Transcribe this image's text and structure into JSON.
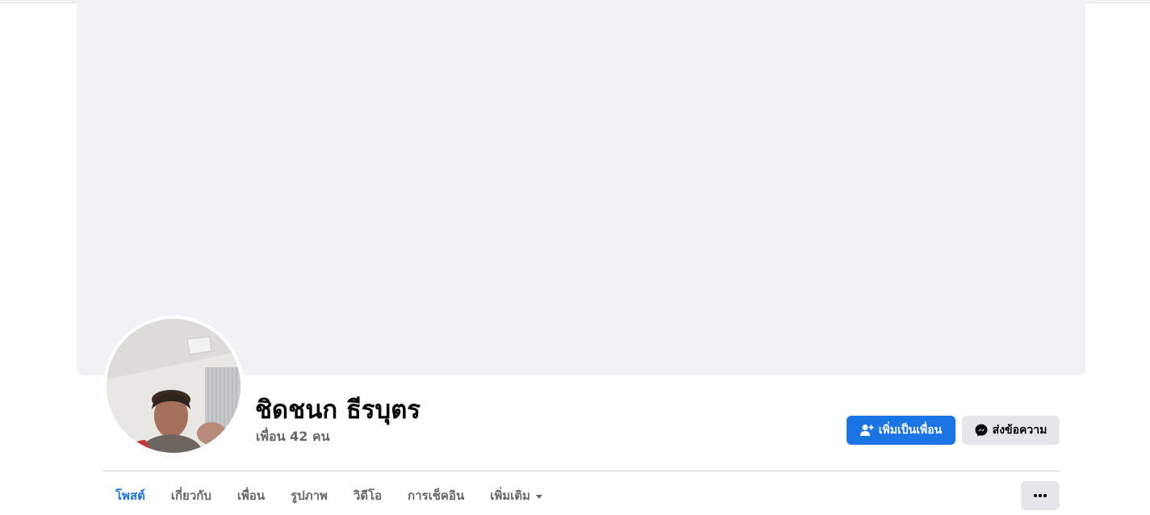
{
  "profile": {
    "name": "ชิดชนก ธีรบุตร",
    "friends_count": "เพื่อน 42 คน"
  },
  "actions": {
    "add_friend_label": "เพิ่มเป็นเพื่อน",
    "message_label": "ส่งข้อความ",
    "add_friend_icon": "person-add-icon",
    "message_icon": "messenger-icon",
    "more_icon": "ellipsis-icon"
  },
  "tabs": [
    {
      "label": "โพสต์",
      "active": true
    },
    {
      "label": "เกี่ยวกับ",
      "active": false
    },
    {
      "label": "เพื่อน",
      "active": false
    },
    {
      "label": "รูปภาพ",
      "active": false
    },
    {
      "label": "วิดีโอ",
      "active": false
    },
    {
      "label": "การเช็คอิน",
      "active": false
    },
    {
      "label": "เพิ่มเติม",
      "active": false
    }
  ],
  "colors": {
    "accent": "#1b74e4",
    "cover": "#f0f2f5",
    "secondary_button": "#e4e6eb",
    "text_primary": "#050505",
    "text_secondary": "#65676b"
  }
}
